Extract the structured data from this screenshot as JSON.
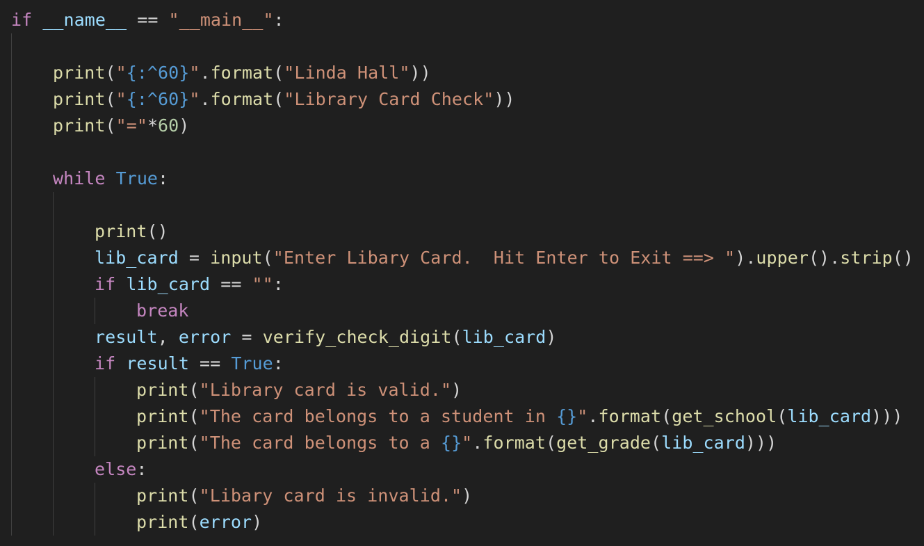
{
  "editor": {
    "theme": {
      "background": "#1f1f1f",
      "keyword": "#c586c0",
      "constant": "#569cd6",
      "function": "#dcdcaa",
      "string": "#ce9178",
      "variable": "#9cdcfe",
      "plain": "#d4d4d4",
      "indent_guide": "#404040"
    },
    "lines": [
      {
        "indent": 0,
        "tokens": [
          {
            "t": "if",
            "c": "kw"
          },
          {
            "t": " ",
            "c": "op"
          },
          {
            "t": "__name__",
            "c": "var"
          },
          {
            "t": " == ",
            "c": "op"
          },
          {
            "t": "\"__main__\"",
            "c": "str"
          },
          {
            "t": ":",
            "c": "punct"
          }
        ]
      },
      {
        "indent": 0,
        "tokens": []
      },
      {
        "indent": 1,
        "tokens": [
          {
            "t": "print",
            "c": "fn"
          },
          {
            "t": "(",
            "c": "punct"
          },
          {
            "t": "\"",
            "c": "str"
          },
          {
            "t": "{:^60}",
            "c": "fmt"
          },
          {
            "t": "\"",
            "c": "str"
          },
          {
            "t": ".",
            "c": "punct"
          },
          {
            "t": "format",
            "c": "fn"
          },
          {
            "t": "(",
            "c": "punct"
          },
          {
            "t": "\"Linda Hall\"",
            "c": "str"
          },
          {
            "t": "))",
            "c": "punct"
          }
        ]
      },
      {
        "indent": 1,
        "tokens": [
          {
            "t": "print",
            "c": "fn"
          },
          {
            "t": "(",
            "c": "punct"
          },
          {
            "t": "\"",
            "c": "str"
          },
          {
            "t": "{:^60}",
            "c": "fmt"
          },
          {
            "t": "\"",
            "c": "str"
          },
          {
            "t": ".",
            "c": "punct"
          },
          {
            "t": "format",
            "c": "fn"
          },
          {
            "t": "(",
            "c": "punct"
          },
          {
            "t": "\"Library Card Check\"",
            "c": "str"
          },
          {
            "t": "))",
            "c": "punct"
          }
        ]
      },
      {
        "indent": 1,
        "tokens": [
          {
            "t": "print",
            "c": "fn"
          },
          {
            "t": "(",
            "c": "punct"
          },
          {
            "t": "\"=\"",
            "c": "str"
          },
          {
            "t": "*",
            "c": "op"
          },
          {
            "t": "60",
            "c": "num"
          },
          {
            "t": ")",
            "c": "punct"
          }
        ]
      },
      {
        "indent": 1,
        "tokens": []
      },
      {
        "indent": 1,
        "tokens": [
          {
            "t": "while",
            "c": "kw"
          },
          {
            "t": " ",
            "c": "op"
          },
          {
            "t": "True",
            "c": "const"
          },
          {
            "t": ":",
            "c": "punct"
          }
        ]
      },
      {
        "indent": 2,
        "tokens": []
      },
      {
        "indent": 2,
        "tokens": [
          {
            "t": "print",
            "c": "fn"
          },
          {
            "t": "()",
            "c": "punct"
          }
        ]
      },
      {
        "indent": 2,
        "tokens": [
          {
            "t": "lib_card",
            "c": "var"
          },
          {
            "t": " = ",
            "c": "op"
          },
          {
            "t": "input",
            "c": "fn"
          },
          {
            "t": "(",
            "c": "punct"
          },
          {
            "t": "\"Enter Libary Card.  Hit Enter to Exit ==> \"",
            "c": "str"
          },
          {
            "t": ").",
            "c": "punct"
          },
          {
            "t": "upper",
            "c": "fn"
          },
          {
            "t": "().",
            "c": "punct"
          },
          {
            "t": "strip",
            "c": "fn"
          },
          {
            "t": "()",
            "c": "punct"
          }
        ]
      },
      {
        "indent": 2,
        "tokens": [
          {
            "t": "if",
            "c": "kw"
          },
          {
            "t": " ",
            "c": "op"
          },
          {
            "t": "lib_card",
            "c": "var"
          },
          {
            "t": " == ",
            "c": "op"
          },
          {
            "t": "\"\"",
            "c": "str"
          },
          {
            "t": ":",
            "c": "punct"
          }
        ]
      },
      {
        "indent": 3,
        "tokens": [
          {
            "t": "break",
            "c": "kw"
          }
        ]
      },
      {
        "indent": 2,
        "tokens": [
          {
            "t": "result",
            "c": "var"
          },
          {
            "t": ", ",
            "c": "punct"
          },
          {
            "t": "error",
            "c": "var"
          },
          {
            "t": " = ",
            "c": "op"
          },
          {
            "t": "verify_check_digit",
            "c": "fn"
          },
          {
            "t": "(",
            "c": "punct"
          },
          {
            "t": "lib_card",
            "c": "var"
          },
          {
            "t": ")",
            "c": "punct"
          }
        ]
      },
      {
        "indent": 2,
        "tokens": [
          {
            "t": "if",
            "c": "kw"
          },
          {
            "t": " ",
            "c": "op"
          },
          {
            "t": "result",
            "c": "var"
          },
          {
            "t": " == ",
            "c": "op"
          },
          {
            "t": "True",
            "c": "const"
          },
          {
            "t": ":",
            "c": "punct"
          }
        ]
      },
      {
        "indent": 3,
        "tokens": [
          {
            "t": "print",
            "c": "fn"
          },
          {
            "t": "(",
            "c": "punct"
          },
          {
            "t": "\"Library card is valid.\"",
            "c": "str"
          },
          {
            "t": ")",
            "c": "punct"
          }
        ]
      },
      {
        "indent": 3,
        "tokens": [
          {
            "t": "print",
            "c": "fn"
          },
          {
            "t": "(",
            "c": "punct"
          },
          {
            "t": "\"The card belongs to a student in ",
            "c": "str"
          },
          {
            "t": "{}",
            "c": "fmt"
          },
          {
            "t": "\"",
            "c": "str"
          },
          {
            "t": ".",
            "c": "punct"
          },
          {
            "t": "format",
            "c": "fn"
          },
          {
            "t": "(",
            "c": "punct"
          },
          {
            "t": "get_school",
            "c": "fn"
          },
          {
            "t": "(",
            "c": "punct"
          },
          {
            "t": "lib_card",
            "c": "var"
          },
          {
            "t": ")))",
            "c": "punct"
          }
        ]
      },
      {
        "indent": 3,
        "tokens": [
          {
            "t": "print",
            "c": "fn"
          },
          {
            "t": "(",
            "c": "punct"
          },
          {
            "t": "\"The card belongs to a ",
            "c": "str"
          },
          {
            "t": "{}",
            "c": "fmt"
          },
          {
            "t": "\"",
            "c": "str"
          },
          {
            "t": ".",
            "c": "punct"
          },
          {
            "t": "format",
            "c": "fn"
          },
          {
            "t": "(",
            "c": "punct"
          },
          {
            "t": "get_grade",
            "c": "fn"
          },
          {
            "t": "(",
            "c": "punct"
          },
          {
            "t": "lib_card",
            "c": "var"
          },
          {
            "t": ")))",
            "c": "punct"
          }
        ]
      },
      {
        "indent": 2,
        "tokens": [
          {
            "t": "else",
            "c": "kw"
          },
          {
            "t": ":",
            "c": "punct"
          }
        ]
      },
      {
        "indent": 3,
        "tokens": [
          {
            "t": "print",
            "c": "fn"
          },
          {
            "t": "(",
            "c": "punct"
          },
          {
            "t": "\"Libary card is invalid.\"",
            "c": "str"
          },
          {
            "t": ")",
            "c": "punct"
          }
        ]
      },
      {
        "indent": 3,
        "tokens": [
          {
            "t": "print",
            "c": "fn"
          },
          {
            "t": "(",
            "c": "punct"
          },
          {
            "t": "error",
            "c": "var"
          },
          {
            "t": ")",
            "c": "punct"
          }
        ]
      }
    ]
  }
}
